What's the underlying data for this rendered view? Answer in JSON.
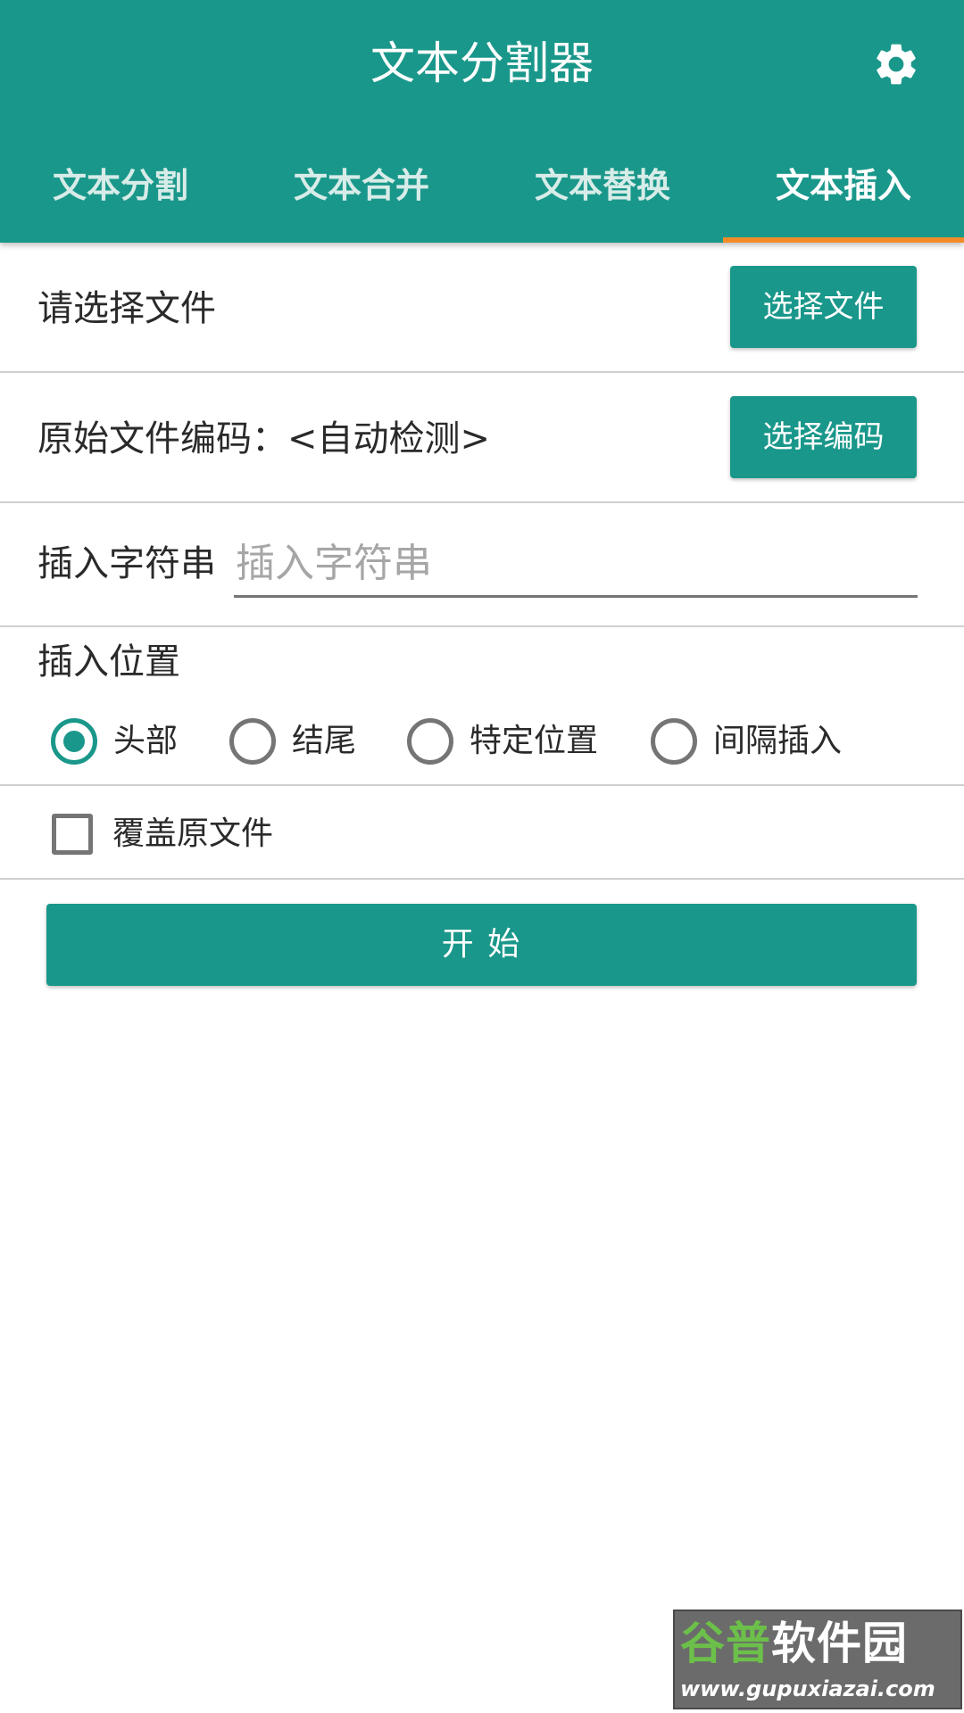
{
  "app": {
    "title": "文本分割器",
    "settings_icon": "gear-icon",
    "accent_color": "#19978a",
    "indicator_color": "#f28c28"
  },
  "tabs": [
    {
      "label": "文本分割",
      "active": false
    },
    {
      "label": "文本合并",
      "active": false
    },
    {
      "label": "文本替换",
      "active": false
    },
    {
      "label": "文本插入",
      "active": true
    }
  ],
  "file_row": {
    "label": "请选择文件",
    "button_label": "选择文件"
  },
  "encoding_row": {
    "label": "原始文件编码：<自动检测>",
    "button_label": "选择编码"
  },
  "insert_string": {
    "label": "插入字符串",
    "value": "",
    "placeholder": "插入字符串"
  },
  "position": {
    "label": "插入位置",
    "options": [
      {
        "label": "头部",
        "checked": true
      },
      {
        "label": "结尾",
        "checked": false
      },
      {
        "label": "特定位置",
        "checked": false
      },
      {
        "label": "间隔插入",
        "checked": false
      }
    ]
  },
  "overwrite": {
    "label": "覆盖原文件",
    "checked": false
  },
  "start_button": {
    "label": "开 始"
  },
  "watermark": {
    "logo_text": "谷普软件园",
    "url": "www.gupuxiazai.com"
  }
}
